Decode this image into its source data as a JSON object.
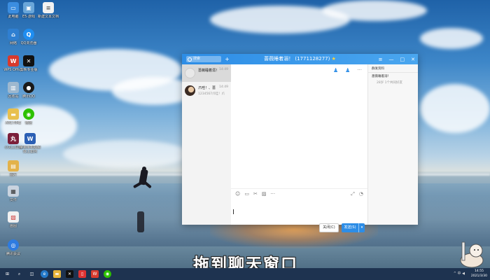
{
  "desktop": {
    "icons": [
      {
        "label": "此电脑",
        "icon": "computer-icon",
        "color": "#3b8de0"
      },
      {
        "label": "E5·游戏",
        "icon": "game-folder-icon",
        "color": "#6aa6d9"
      },
      {
        "label": "新建文本文档",
        "icon": "text-file-icon",
        "color": "#f2f2f2"
      },
      {
        "label": "网络",
        "icon": "network-icon",
        "color": "#2f7fd1"
      },
      {
        "label": "QQ浏览器",
        "icon": "qq-browser-icon",
        "color": "#1f8ef1"
      },
      {
        "label": "WPS Office",
        "icon": "wps-icon",
        "color": "#d83a2d"
      },
      {
        "label": "剪映专业版",
        "icon": "capcut-icon",
        "color": "#111111"
      },
      {
        "label": "回收站",
        "icon": "recycle-bin-icon",
        "color": "#9db8cf"
      },
      {
        "label": "腾讯QQ",
        "icon": "qq-penguin-icon",
        "color": "#1a1a1a"
      },
      {
        "label": "ARCTIME",
        "icon": "folder-icon",
        "color": "#e8c04e"
      },
      {
        "label": "微信",
        "icon": "wechat-icon",
        "color": "#2dc100"
      },
      {
        "label": "小丸工具箱",
        "icon": "toolbox-icon",
        "color": "#7b1f3a"
      },
      {
        "label": "苹果手机视频",
        "label2": "转上如何",
        "icon": "word-doc-icon",
        "color": "#2b5fb4"
      },
      {
        "label": "图片",
        "icon": "picture-folder-icon",
        "color": "#e3b24a"
      },
      {
        "label": "文件",
        "icon": "doc-folder-icon",
        "color": "#c9d3df"
      },
      {
        "label": "画图",
        "icon": "paint-doc-icon",
        "color": "#f1f1f1"
      },
      {
        "label": "腾讯会议",
        "icon": "meeting-icon",
        "color": "#2e7be0"
      }
    ]
  },
  "qq_window": {
    "search_placeholder": "搜索",
    "add_label": "+",
    "title": "蔷薇睡着溺！ (1771128277)",
    "title_star": "★",
    "window_buttons": {
      "more": "≡",
      "minimize": "—",
      "maximize": "□",
      "close": "✕"
    },
    "contacts": [
      {
        "name": "蔷薇睡着溺！",
        "time": "14:49",
        "last": "",
        "active": true,
        "avatar_color": "#e8e8e8"
      },
      {
        "name": "爪哇！、蔷",
        "time": "14:49",
        "last": "1234567爪哇！爪",
        "active": false,
        "avatar_color": "#3a2a22"
      }
    ],
    "chat": {
      "top_tools": [
        "add-contact-icon",
        "add-group-icon"
      ],
      "more": "···",
      "input_tools": [
        "☺",
        "▭",
        "✂",
        "▨",
        "···"
      ],
      "input_tools_right": [
        "⤢",
        "◔"
      ],
      "close_label": "关闭(C)",
      "send_label": "发送(S)",
      "send_arrow": "▾"
    },
    "side": {
      "tab": "群发资料",
      "group_name": "蔷薇睡着溺！",
      "info": "28岁 1个共同好友"
    }
  },
  "caption": "拖到聊天窗口",
  "taskbar": {
    "clock_time": "14:55",
    "clock_date": "2021/3/30",
    "tray_text": "^ 中 ◀"
  },
  "accent_color": "#2d8de6"
}
